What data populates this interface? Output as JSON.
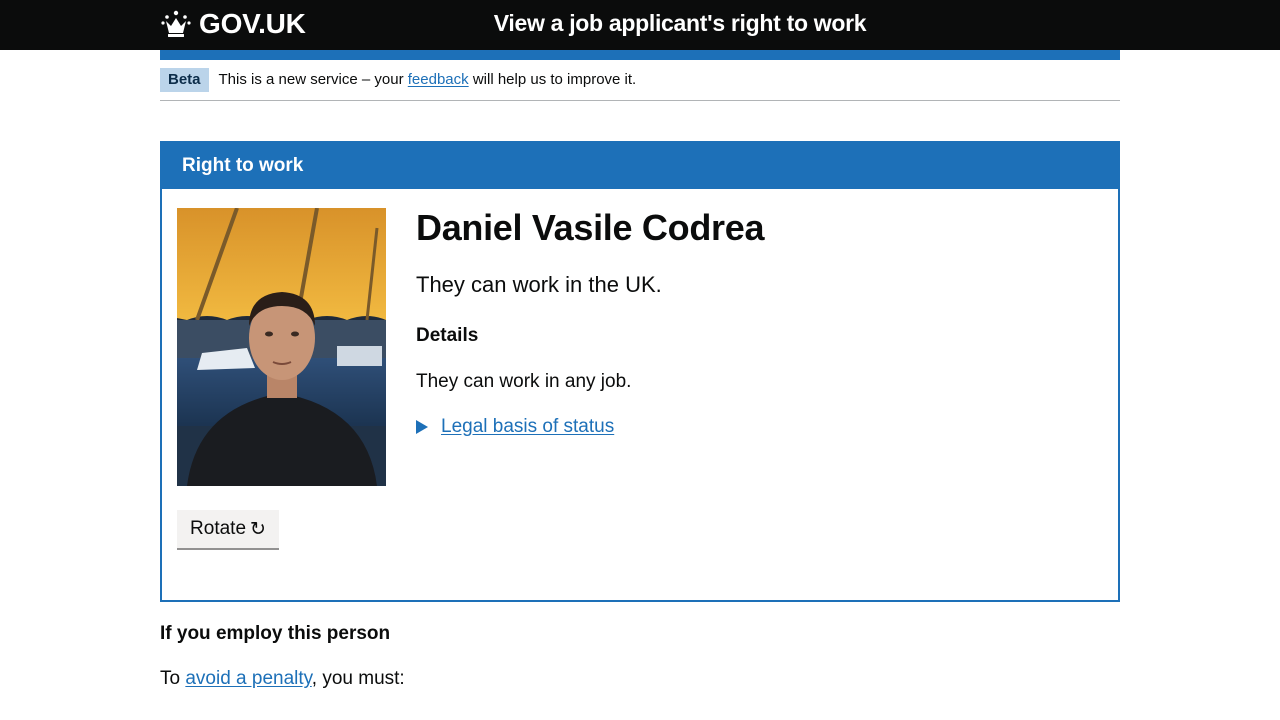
{
  "header": {
    "logo_text": "GOV.UK",
    "service_name": "View a job applicant's right to work"
  },
  "phase_banner": {
    "tag": "Beta",
    "text_before": "This is a new service – your ",
    "link_text": "feedback",
    "text_after": " will help us to improve it."
  },
  "panel": {
    "heading": "Right to work",
    "person_name": "Daniel Vasile Codrea",
    "status": "They can work in the UK.",
    "details_heading": "Details",
    "details_text": "They can work in any job.",
    "legal_link": "Legal basis of status",
    "rotate_label": "Rotate",
    "rotate_icon": "↻"
  },
  "employ": {
    "heading": "If you employ this person",
    "text_before": "To ",
    "link_text": "avoid a penalty",
    "text_after": ", you must:"
  },
  "colors": {
    "header_bg": "#0b0c0c",
    "brand_blue": "#1d70b8",
    "beta_tag_bg": "#bbd4ea",
    "button_bg": "#f3f2f1"
  }
}
